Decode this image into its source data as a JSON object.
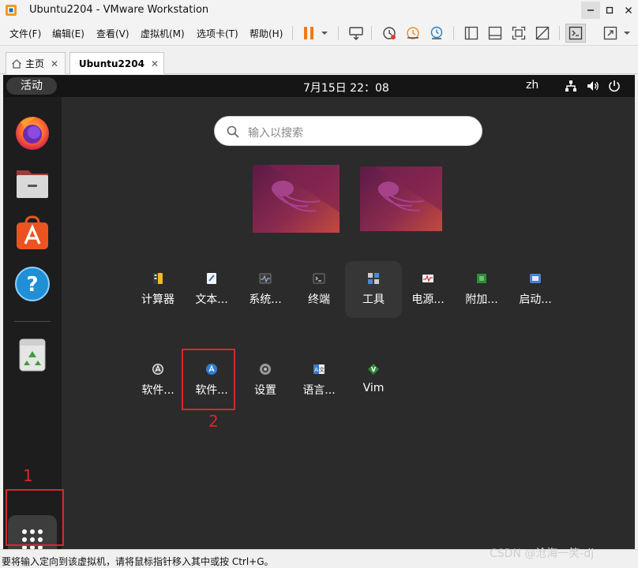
{
  "window": {
    "title": "Ubuntu2204 - VMware Workstation",
    "min_icon": "minimize-icon",
    "max_icon": "maximize-icon",
    "close_icon": "close-icon"
  },
  "menu": [
    {
      "label": "文件(F)"
    },
    {
      "label": "编辑(E)"
    },
    {
      "label": "查看(V)"
    },
    {
      "label": "虚拟机(M)"
    },
    {
      "label": "选项卡(T)"
    },
    {
      "label": "帮助(H)"
    }
  ],
  "tabs": [
    {
      "label": "主页",
      "icon": "home-icon"
    },
    {
      "label": "Ubuntu2204",
      "icon": "vm-running-icon",
      "active": true
    }
  ],
  "ubuntu": {
    "activities": "活动",
    "clock": "7月15日  22：08",
    "language": "zh",
    "search_placeholder": "输入以搜索",
    "apps_row1": [
      {
        "label": "计算器",
        "icon": "calculator-icon"
      },
      {
        "label": "文本...",
        "icon": "text-editor-icon"
      },
      {
        "label": "系统...",
        "icon": "system-monitor-icon"
      },
      {
        "label": "终端",
        "icon": "terminal-icon"
      },
      {
        "label": "工具",
        "icon": "utilities-folder-icon"
      },
      {
        "label": "电源...",
        "icon": "power-statistics-icon"
      },
      {
        "label": "附加...",
        "icon": "additional-drivers-icon"
      },
      {
        "label": "启动...",
        "icon": "startup-disk-icon"
      }
    ],
    "apps_row2": [
      {
        "label": "软件...",
        "icon": "software-updater-icon"
      },
      {
        "label": "软件...",
        "icon": "software-store-icon"
      },
      {
        "label": "设置",
        "icon": "settings-icon"
      },
      {
        "label": "语言...",
        "icon": "language-support-icon"
      },
      {
        "label": "Vim",
        "icon": "vim-icon"
      }
    ]
  },
  "annotations": {
    "marker1": "1",
    "marker2": "2",
    "color": "#d8262c"
  },
  "status": {
    "text": "要将输入定向到该虚拟机，请将鼠标指针移入其中或按 Ctrl+G。"
  },
  "watermark": "CSDN @沧海一笑-dj"
}
